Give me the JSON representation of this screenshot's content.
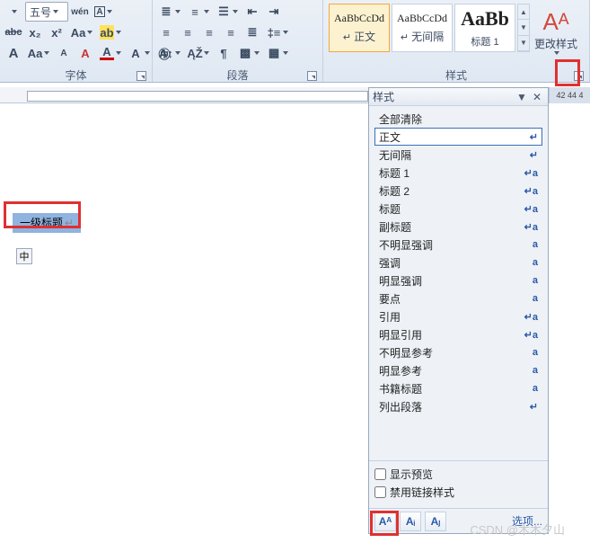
{
  "ribbon": {
    "font": {
      "size": "五号",
      "grow": "A",
      "shrink": "A",
      "ruby": "wén",
      "charbox": "A",
      "strike": "abc",
      "sub": "x₂",
      "sup": "x²",
      "case": "Aa",
      "hilite": "ab",
      "fontcolor": "A",
      "clear": "A",
      "charfx": "A",
      "enclose": "㊥",
      "label": "字体"
    },
    "para": {
      "label": "段落"
    },
    "styles": {
      "label": "样式",
      "items": [
        {
          "preview": "AaBbCcDd",
          "label": "正文",
          "size": "13px",
          "sel": true
        },
        {
          "preview": "AaBbCcDd",
          "label": "无间隔",
          "size": "13px"
        },
        {
          "preview": "AaBb",
          "label": "标题 1",
          "size": "22px"
        }
      ],
      "change": "更改样式"
    }
  },
  "ruler_end": "42  44  4",
  "doc": {
    "selected": "一级标题",
    "anchor": "中"
  },
  "pane": {
    "title": "样式",
    "items": [
      {
        "t": "全部清除",
        "m": ""
      },
      {
        "t": "正文",
        "m": "para",
        "sel": true
      },
      {
        "t": "无间隔",
        "m": "para"
      },
      {
        "t": "标题 1",
        "m": "link"
      },
      {
        "t": "标题 2",
        "m": "link"
      },
      {
        "t": "标题",
        "m": "link"
      },
      {
        "t": "副标题",
        "m": "link"
      },
      {
        "t": "不明显强调",
        "m": "char"
      },
      {
        "t": "强调",
        "m": "char"
      },
      {
        "t": "明显强调",
        "m": "char"
      },
      {
        "t": "要点",
        "m": "char"
      },
      {
        "t": "引用",
        "m": "link"
      },
      {
        "t": "明显引用",
        "m": "link"
      },
      {
        "t": "不明显参考",
        "m": "char"
      },
      {
        "t": "明显参考",
        "m": "char"
      },
      {
        "t": "书籍标题",
        "m": "char"
      },
      {
        "t": "列出段落",
        "m": "para"
      }
    ],
    "show_preview": "显示预览",
    "disable_linked": "禁用链接样式",
    "options": "选项..."
  },
  "watermark": "CSDN @木木夕山"
}
